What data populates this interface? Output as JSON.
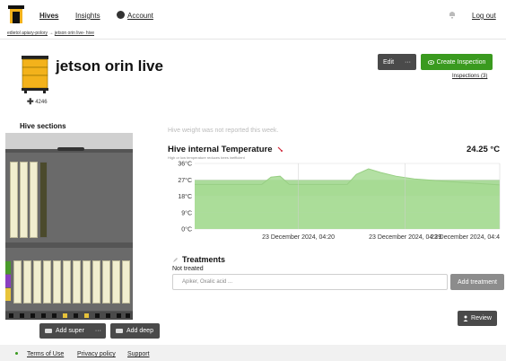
{
  "nav": {
    "hives": "Hives",
    "insights": "Insights",
    "account": "Account",
    "logout": "Log out"
  },
  "breadcrumb": {
    "apiary": "edietol apiary-polory",
    "separator": "→",
    "hive": "jetson orin live- hive"
  },
  "hive": {
    "name": "jetson orin live",
    "weight_label": "4246",
    "edit_label": "Edit",
    "edit_more": "···",
    "create_inspection_label": "Create Inspection",
    "inspections_link": "Inspections (3)"
  },
  "sections": {
    "label": "Hive sections",
    "add_super_label": "Add super",
    "add_super_more": "···",
    "add_deep_label": "Add deep"
  },
  "weight_note": "Hive weight was not reported this week.",
  "temperature": {
    "title": "Hive internal Temperature",
    "subnote": "High or low temperature reduces bees inefficient",
    "current_value": "24.25 °C"
  },
  "chart_data": {
    "type": "area",
    "title": "Hive internal Temperature",
    "y_ticks": [
      "36°C",
      "27°C",
      "18°C",
      "9°C",
      "0°C"
    ],
    "ylim": [
      0,
      36
    ],
    "x_tick_labels": [
      "23 December 2024, 04:20",
      "23 December 2024, 04:29",
      "23 December 2024, 04:4"
    ],
    "series": [
      {
        "x": [
          0,
          0.22,
          0.25,
          0.28,
          0.31,
          0.5,
          0.53,
          0.57,
          0.61,
          0.66,
          0.72,
          0.8,
          0.88,
          0.95,
          1.0
        ],
        "values": [
          24.5,
          24.5,
          28.5,
          29,
          24.5,
          24.5,
          30,
          33,
          31,
          29,
          27.5,
          26.5,
          25.5,
          24.8,
          24.25
        ]
      }
    ],
    "bands": [
      {
        "from": 18,
        "to": 27,
        "color": "#8fcf7a"
      },
      {
        "from": 0,
        "to": 18,
        "color": "#b4e3a2"
      }
    ],
    "grid": true,
    "colors": {
      "line": "#98cf84",
      "fill": "#a6da93"
    }
  },
  "treatments": {
    "title": "Treatments",
    "status": "Not treated",
    "placeholder": "Apiker, Oxalic acid ...",
    "add_label": "Add treatment"
  },
  "review_label": "Review",
  "footer": {
    "terms": "Terms of Use",
    "privacy": "Privacy policy",
    "support": "Support"
  },
  "colors": {
    "primary_green": "#3a9a1f",
    "dark_button": "#4a4a4a",
    "hive_yellow": "#f3b21b"
  }
}
